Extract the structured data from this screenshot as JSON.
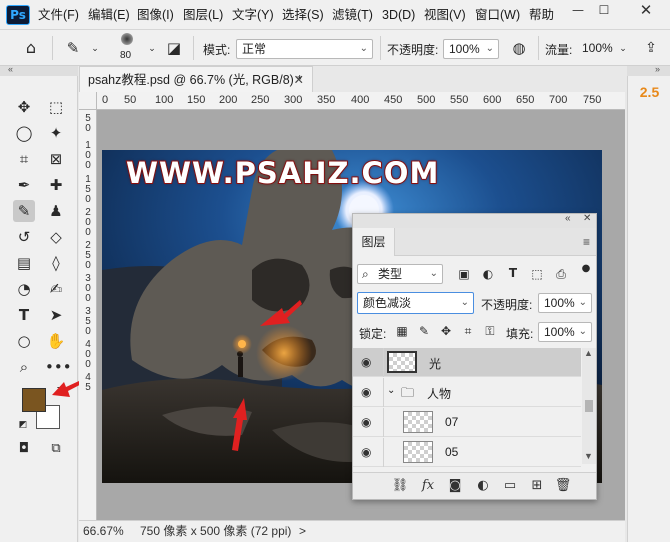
{
  "menubar": {
    "items": [
      "文件(F)",
      "编辑(E)",
      "图像(I)",
      "图层(L)",
      "文字(Y)",
      "选择(S)",
      "滤镜(T)",
      "3D(D)",
      "视图(V)",
      "窗口(W)",
      "帮助"
    ],
    "logo": "Ps"
  },
  "options": {
    "brush_size": "80",
    "mode_label": "模式:",
    "mode_value": "正常",
    "opacity_label": "不透明度:",
    "opacity_value": "100%",
    "flow_label": "流量:",
    "flow_value": "100%"
  },
  "document": {
    "tab_title": "psahz教程.psd @ 66.7% (光, RGB/8) *",
    "canvas_text": "WWW.PSAHZ.COM",
    "ruler_h": [
      "0",
      "50",
      "100",
      "150",
      "200",
      "250",
      "300",
      "350",
      "400",
      "450",
      "500",
      "550",
      "600",
      "650",
      "700",
      "750"
    ],
    "ruler_v": [
      "5",
      "0",
      "1",
      "0",
      "0",
      "1",
      "5",
      "0",
      "2",
      "0",
      "0",
      "2",
      "5",
      "0",
      "3",
      "0",
      "0",
      "3",
      "5",
      "0",
      "4",
      "0",
      "0",
      "4",
      "5"
    ]
  },
  "status": {
    "zoom": "66.67%",
    "info": "750 像素 x 500 像素 (72 ppi)",
    "arrow": ">"
  },
  "right_panel": {
    "value": "2.5"
  },
  "colors": {
    "foreground": "#7a5520",
    "background": "#ffffff",
    "accent": "#e8891a",
    "arrow_red": "#e02020"
  },
  "layers_panel": {
    "tab": "图层",
    "filter_kind": "类型",
    "blend_mode": "颜色减淡",
    "opacity_label": "不透明度:",
    "opacity_value": "100%",
    "lock_label": "锁定:",
    "fill_label": "填充:",
    "fill_value": "100%",
    "layers": [
      {
        "name": "光",
        "selected": true
      },
      {
        "name": "人物",
        "group": true
      },
      {
        "name": "07"
      },
      {
        "name": "05"
      }
    ],
    "fx_label": "fx"
  },
  "icons": {
    "tools": [
      "move-icon",
      "marquee-icon",
      "lasso-icon",
      "magic-wand-icon",
      "crop-icon",
      "frame-icon",
      "eyedropper-icon",
      "healing-icon",
      "brush-icon",
      "stamp-icon",
      "history-brush-icon",
      "eraser-icon",
      "gradient-icon",
      "blur-icon",
      "dodge-icon",
      "pen-icon",
      "type-icon",
      "path-select-icon",
      "ellipse-icon",
      "hand-icon",
      "zoom-icon",
      "more-icon"
    ]
  }
}
